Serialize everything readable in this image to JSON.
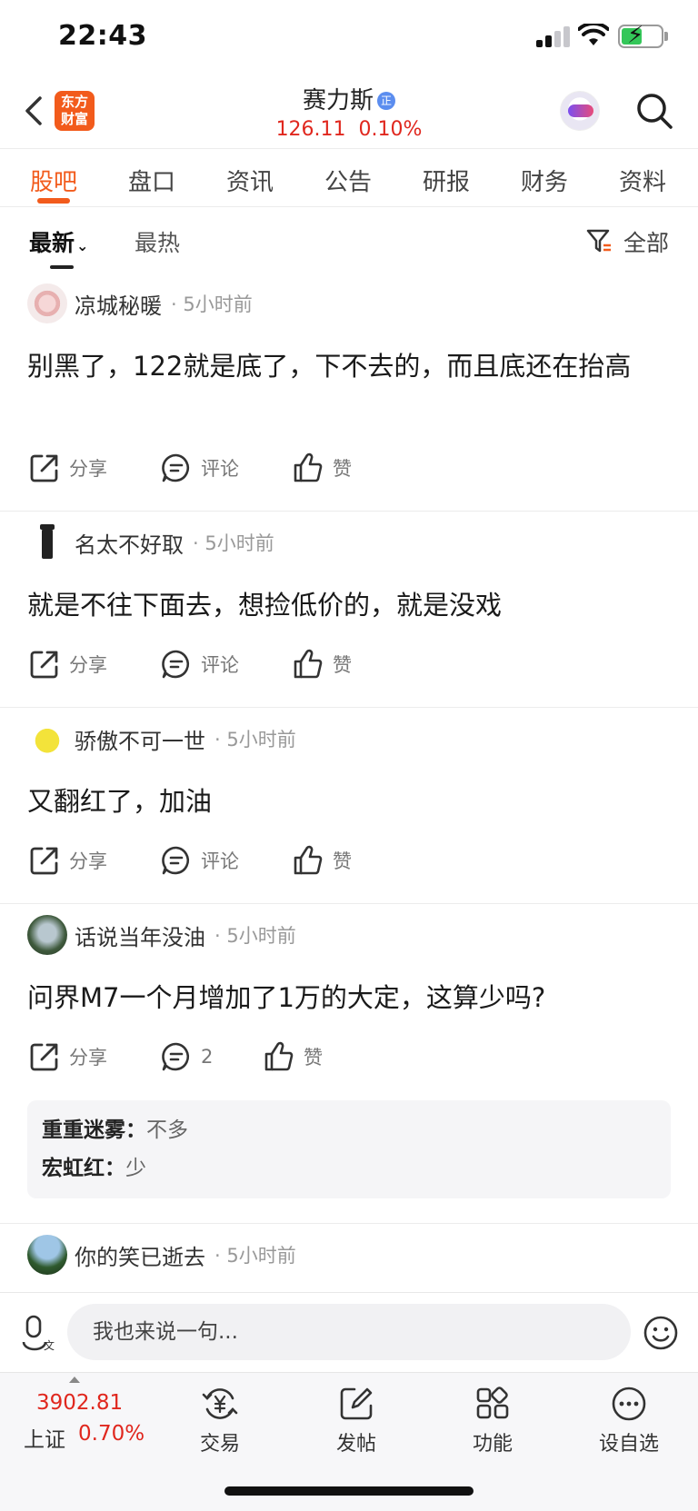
{
  "status_bar": {
    "time": "22:43"
  },
  "header": {
    "logo_line1": "东方",
    "logo_line2": "财富",
    "stock_name": "赛力斯",
    "verified_badge": "正",
    "price": "126.11",
    "change": "0.10%"
  },
  "tabs": [
    {
      "label": "股吧",
      "active": true
    },
    {
      "label": "盘口"
    },
    {
      "label": "资讯"
    },
    {
      "label": "公告"
    },
    {
      "label": "研报"
    },
    {
      "label": "财务"
    },
    {
      "label": "资料"
    }
  ],
  "sort": {
    "latest": "最新",
    "hot": "最热",
    "filter": "全部"
  },
  "actions": {
    "share": "分享",
    "comment": "评论",
    "like": "赞"
  },
  "posts": [
    {
      "author": "凉城秘暖",
      "time": "· 5小时前",
      "content": "别黑了，122就是底了，下不去的，而且底还在抬高"
    },
    {
      "author": "名太不好取",
      "time": "· 5小时前",
      "content": "就是不往下面去，想捡低价的，就是没戏"
    },
    {
      "author": "骄傲不可一世",
      "time": "· 5小时前",
      "content": "又翻红了，加油"
    },
    {
      "author": "话说当年没油",
      "time": "· 5小时前",
      "content": "问界M7一个月增加了1万的大定，这算少吗?",
      "comment_count": "2",
      "replies": [
        {
          "user": "重重迷雾：",
          "text": "不多"
        },
        {
          "user": "宏虹红：",
          "text": "少"
        }
      ]
    },
    {
      "author": "你的笑已逝去",
      "time": "· 5小时前"
    }
  ],
  "input": {
    "placeholder": "我也来说一句..."
  },
  "bottom_nav": {
    "index_value": "3902.81",
    "index_name": "上证",
    "index_change": "0.70%",
    "items": [
      {
        "label": "交易",
        "icon": "yuan-exchange-icon"
      },
      {
        "label": "发帖",
        "icon": "edit-icon"
      },
      {
        "label": "功能",
        "icon": "grid-icon"
      },
      {
        "label": "设自选",
        "icon": "more-icon"
      }
    ]
  },
  "colors": {
    "accent": "#f25b1c",
    "rise": "#e0271e"
  }
}
